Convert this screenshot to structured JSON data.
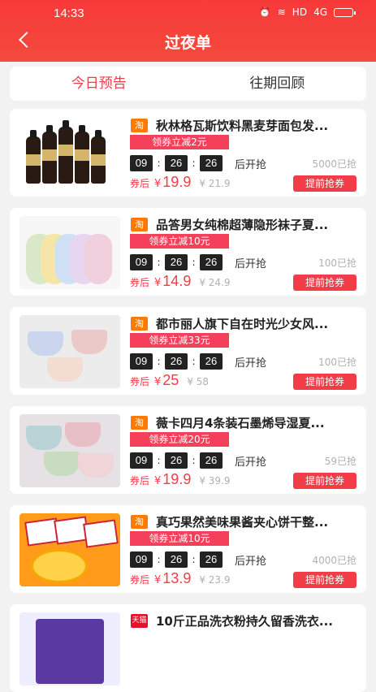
{
  "status": {
    "time": "14:33",
    "signal_text": "HD",
    "network": "4G"
  },
  "header": {
    "title": "过夜单"
  },
  "tabs": [
    {
      "label": "今日预告",
      "active": true
    },
    {
      "label": "往期回顾",
      "active": false
    }
  ],
  "products": [
    {
      "platform": "淘",
      "title": "秋林格瓦斯饮料黑麦芽面包发...",
      "coupon": "领券立减2元",
      "timer": [
        "09",
        "26",
        "26"
      ],
      "start_label": "后开抢",
      "sold": "5000已抢",
      "after_label": "券后",
      "yen": "¥",
      "price": "19.9",
      "original": "¥ 21.9",
      "button": "提前抢券"
    },
    {
      "platform": "淘",
      "title": "品答男女纯棉超薄隐形袜子夏...",
      "coupon": "领券立减10元",
      "timer": [
        "09",
        "26",
        "26"
      ],
      "start_label": "后开抢",
      "sold": "100已抢",
      "after_label": "券后",
      "yen": "¥",
      "price": "14.9",
      "original": "¥ 24.9",
      "button": "提前抢券"
    },
    {
      "platform": "淘",
      "title": "都市丽人旗下自在时光少女风...",
      "coupon": "领券立减33元",
      "timer": [
        "09",
        "26",
        "26"
      ],
      "start_label": "后开抢",
      "sold": "100已抢",
      "after_label": "券后",
      "yen": "¥",
      "price": "25",
      "original": "¥ 58",
      "button": "提前抢券"
    },
    {
      "platform": "淘",
      "title": "薇卡四月4条装石墨烯导湿夏...",
      "coupon": "领券立减20元",
      "timer": [
        "09",
        "26",
        "26"
      ],
      "start_label": "后开抢",
      "sold": "59已抢",
      "after_label": "券后",
      "yen": "¥",
      "price": "19.9",
      "original": "¥ 39.9",
      "button": "提前抢券"
    },
    {
      "platform": "淘",
      "title": "真巧果然美味果酱夹心饼干整...",
      "coupon": "领券立减10元",
      "timer": [
        "09",
        "26",
        "26"
      ],
      "start_label": "后开抢",
      "sold": "4000已抢",
      "after_label": "券后",
      "yen": "¥",
      "price": "13.9",
      "original": "¥ 23.9",
      "button": "提前抢券"
    },
    {
      "platform": "天猫",
      "title": "10斤正品洗衣粉持久留香洗衣..."
    }
  ],
  "colors": {
    "brand_red": "#f23c48",
    "header_red": "#f83a3a",
    "taobao_orange": "#ff7a00",
    "tmall_red": "#e8102a"
  }
}
